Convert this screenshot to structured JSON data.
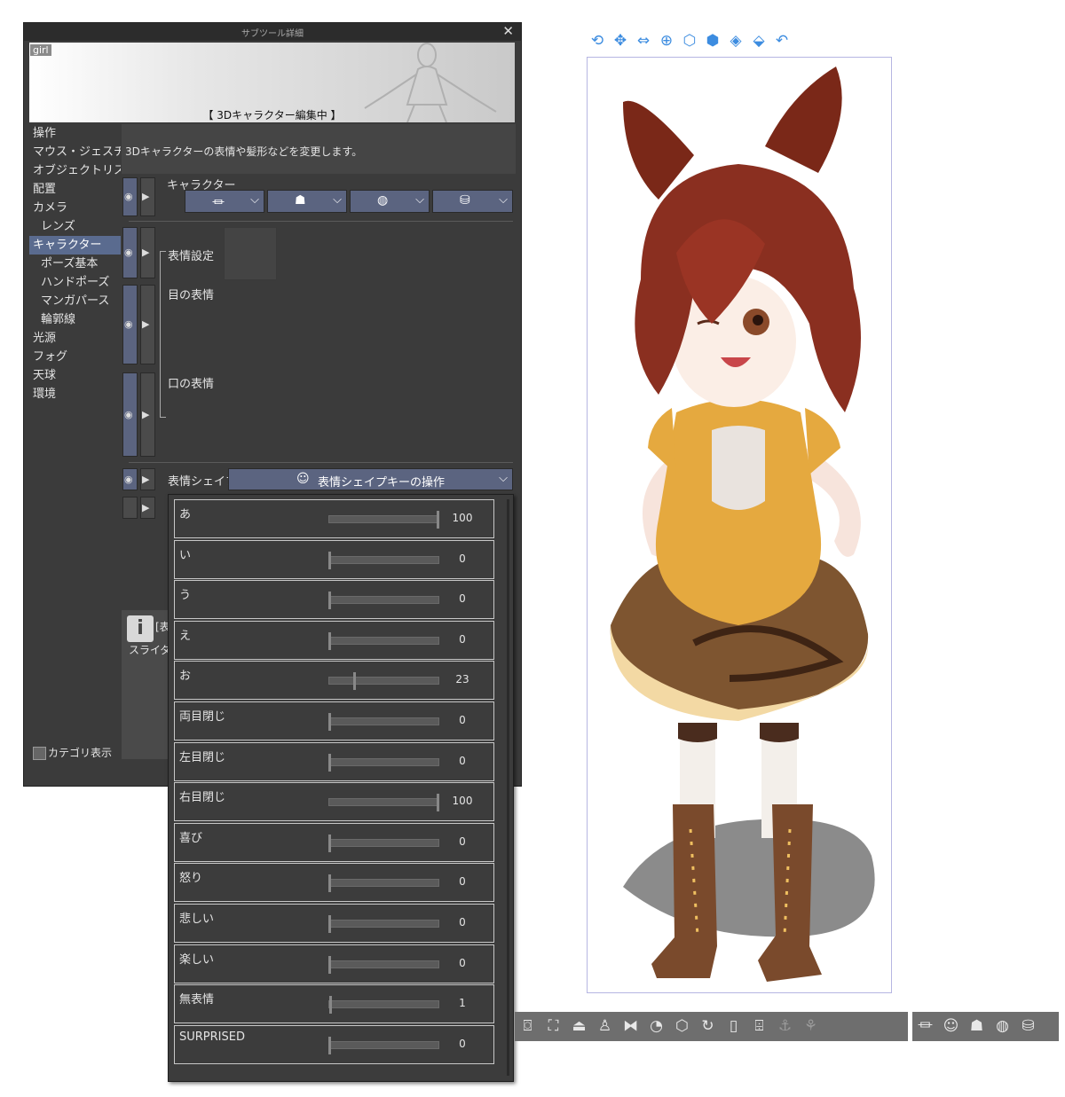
{
  "panel": {
    "title": "サブツール詳細",
    "close": "✕",
    "preview_tag": "girl",
    "preview_caption": "【 3Dキャラクター編集中 】",
    "description": "3Dキャラクターの表情や髪形などを変更します。",
    "categories": [
      {
        "label": "操作"
      },
      {
        "label": "マウス・ジェスチャー"
      },
      {
        "label": "オブジェクトリスト"
      },
      {
        "label": "配置"
      },
      {
        "label": "カメラ"
      },
      {
        "label": "レンズ"
      },
      {
        "label": "キャラクター"
      },
      {
        "label": "ポーズ基本"
      },
      {
        "label": "ハンドポーズ"
      },
      {
        "label": "マンガパース"
      },
      {
        "label": "輪郭線"
      },
      {
        "label": "光源"
      },
      {
        "label": "フォグ"
      },
      {
        "label": "天球"
      },
      {
        "label": "環境"
      }
    ],
    "selected_category": "キャラクター",
    "character_label": "キャラクター",
    "expression_settings_label": "表情設定",
    "eye_expression_label": "目の表情",
    "mouth_expression_label": "口の表情",
    "expression_shape_label": "表情シェイプ",
    "expression_shape_dropdown": "表情シェイプキーの操作",
    "info_title": "[表",
    "info_text": "スライダ",
    "category_display": "カテゴリ表示"
  },
  "icons": {
    "eye": "eye-icon",
    "expand": "play-triangle-icon",
    "chevron": "chevron-down-icon",
    "info": "info-icon",
    "accent": "#5b6480",
    "tool_blue": "#3c8ce0"
  },
  "shape_keys": [
    {
      "name": "あ",
      "value": "100",
      "level": 1.0
    },
    {
      "name": "い",
      "value": "0",
      "level": 0.0
    },
    {
      "name": "う",
      "value": "0",
      "level": 0.0
    },
    {
      "name": "え",
      "value": "0",
      "level": 0.0
    },
    {
      "name": "お",
      "value": "23",
      "level": 0.23
    },
    {
      "name": "両目閉じ",
      "value": "0",
      "level": 0.0
    },
    {
      "name": "左目閉じ",
      "value": "0",
      "level": 0.0
    },
    {
      "name": "右目閉じ",
      "value": "100",
      "level": 1.0
    },
    {
      "name": "喜び",
      "value": "0",
      "level": 0.0
    },
    {
      "name": "怒り",
      "value": "0",
      "level": 0.0
    },
    {
      "name": "悲しい",
      "value": "0",
      "level": 0.0
    },
    {
      "name": "楽しい",
      "value": "0",
      "level": 0.0
    },
    {
      "name": "無表情",
      "value": "1",
      "level": 0.01
    },
    {
      "name": "SURPRISED",
      "value": "0",
      "level": 0.0
    }
  ]
}
